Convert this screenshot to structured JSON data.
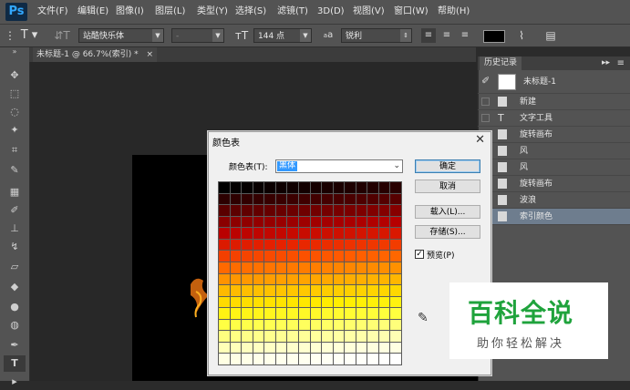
{
  "app": {
    "logo": "Ps"
  },
  "menu": [
    "文件(F)",
    "编辑(E)",
    "图像(I)",
    "图层(L)",
    "类型(Y)",
    "选择(S)",
    "滤镜(T)",
    "3D(D)",
    "视图(V)",
    "窗口(W)",
    "帮助(H)"
  ],
  "options": {
    "font_family": "站酷快乐体",
    "font_style": "-",
    "font_size": "144 点",
    "aa_label": "a",
    "aa_value": "锐利"
  },
  "document": {
    "tab_title": "未标题-1 @ 66.7%(索引) *",
    "close": "×"
  },
  "history": {
    "tab": "历史记录",
    "snapshot_label": "未标题-1",
    "items": [
      {
        "label": "新建",
        "icon": "document-icon"
      },
      {
        "label": "文字工具",
        "icon": "type-icon"
      },
      {
        "label": "旋转画布",
        "icon": "document-icon"
      },
      {
        "label": "风",
        "icon": "document-icon"
      },
      {
        "label": "风",
        "icon": "document-icon"
      },
      {
        "label": "旋转画布",
        "icon": "document-icon"
      },
      {
        "label": "波浪",
        "icon": "document-icon"
      },
      {
        "label": "索引颜色",
        "icon": "document-icon",
        "selected": true
      }
    ]
  },
  "dialog": {
    "title": "颜色表",
    "table_label": "颜色表(T):",
    "table_value": "黑体",
    "ok": "确定",
    "cancel": "取消",
    "load": "载入(L)...",
    "save": "存储(S)...",
    "preview_label": "预览(P)",
    "preview_checked": true,
    "palette_stops": [
      "#000000",
      "#3a0000",
      "#7a0000",
      "#b80000",
      "#e62200",
      "#ff5a00",
      "#ff9200",
      "#ffc400",
      "#ffee00",
      "#ffff40",
      "#ffff90",
      "#ffffd8",
      "#ffffff"
    ]
  },
  "watermark": {
    "title": "百科全说",
    "subtitle": "助你轻松解决"
  }
}
